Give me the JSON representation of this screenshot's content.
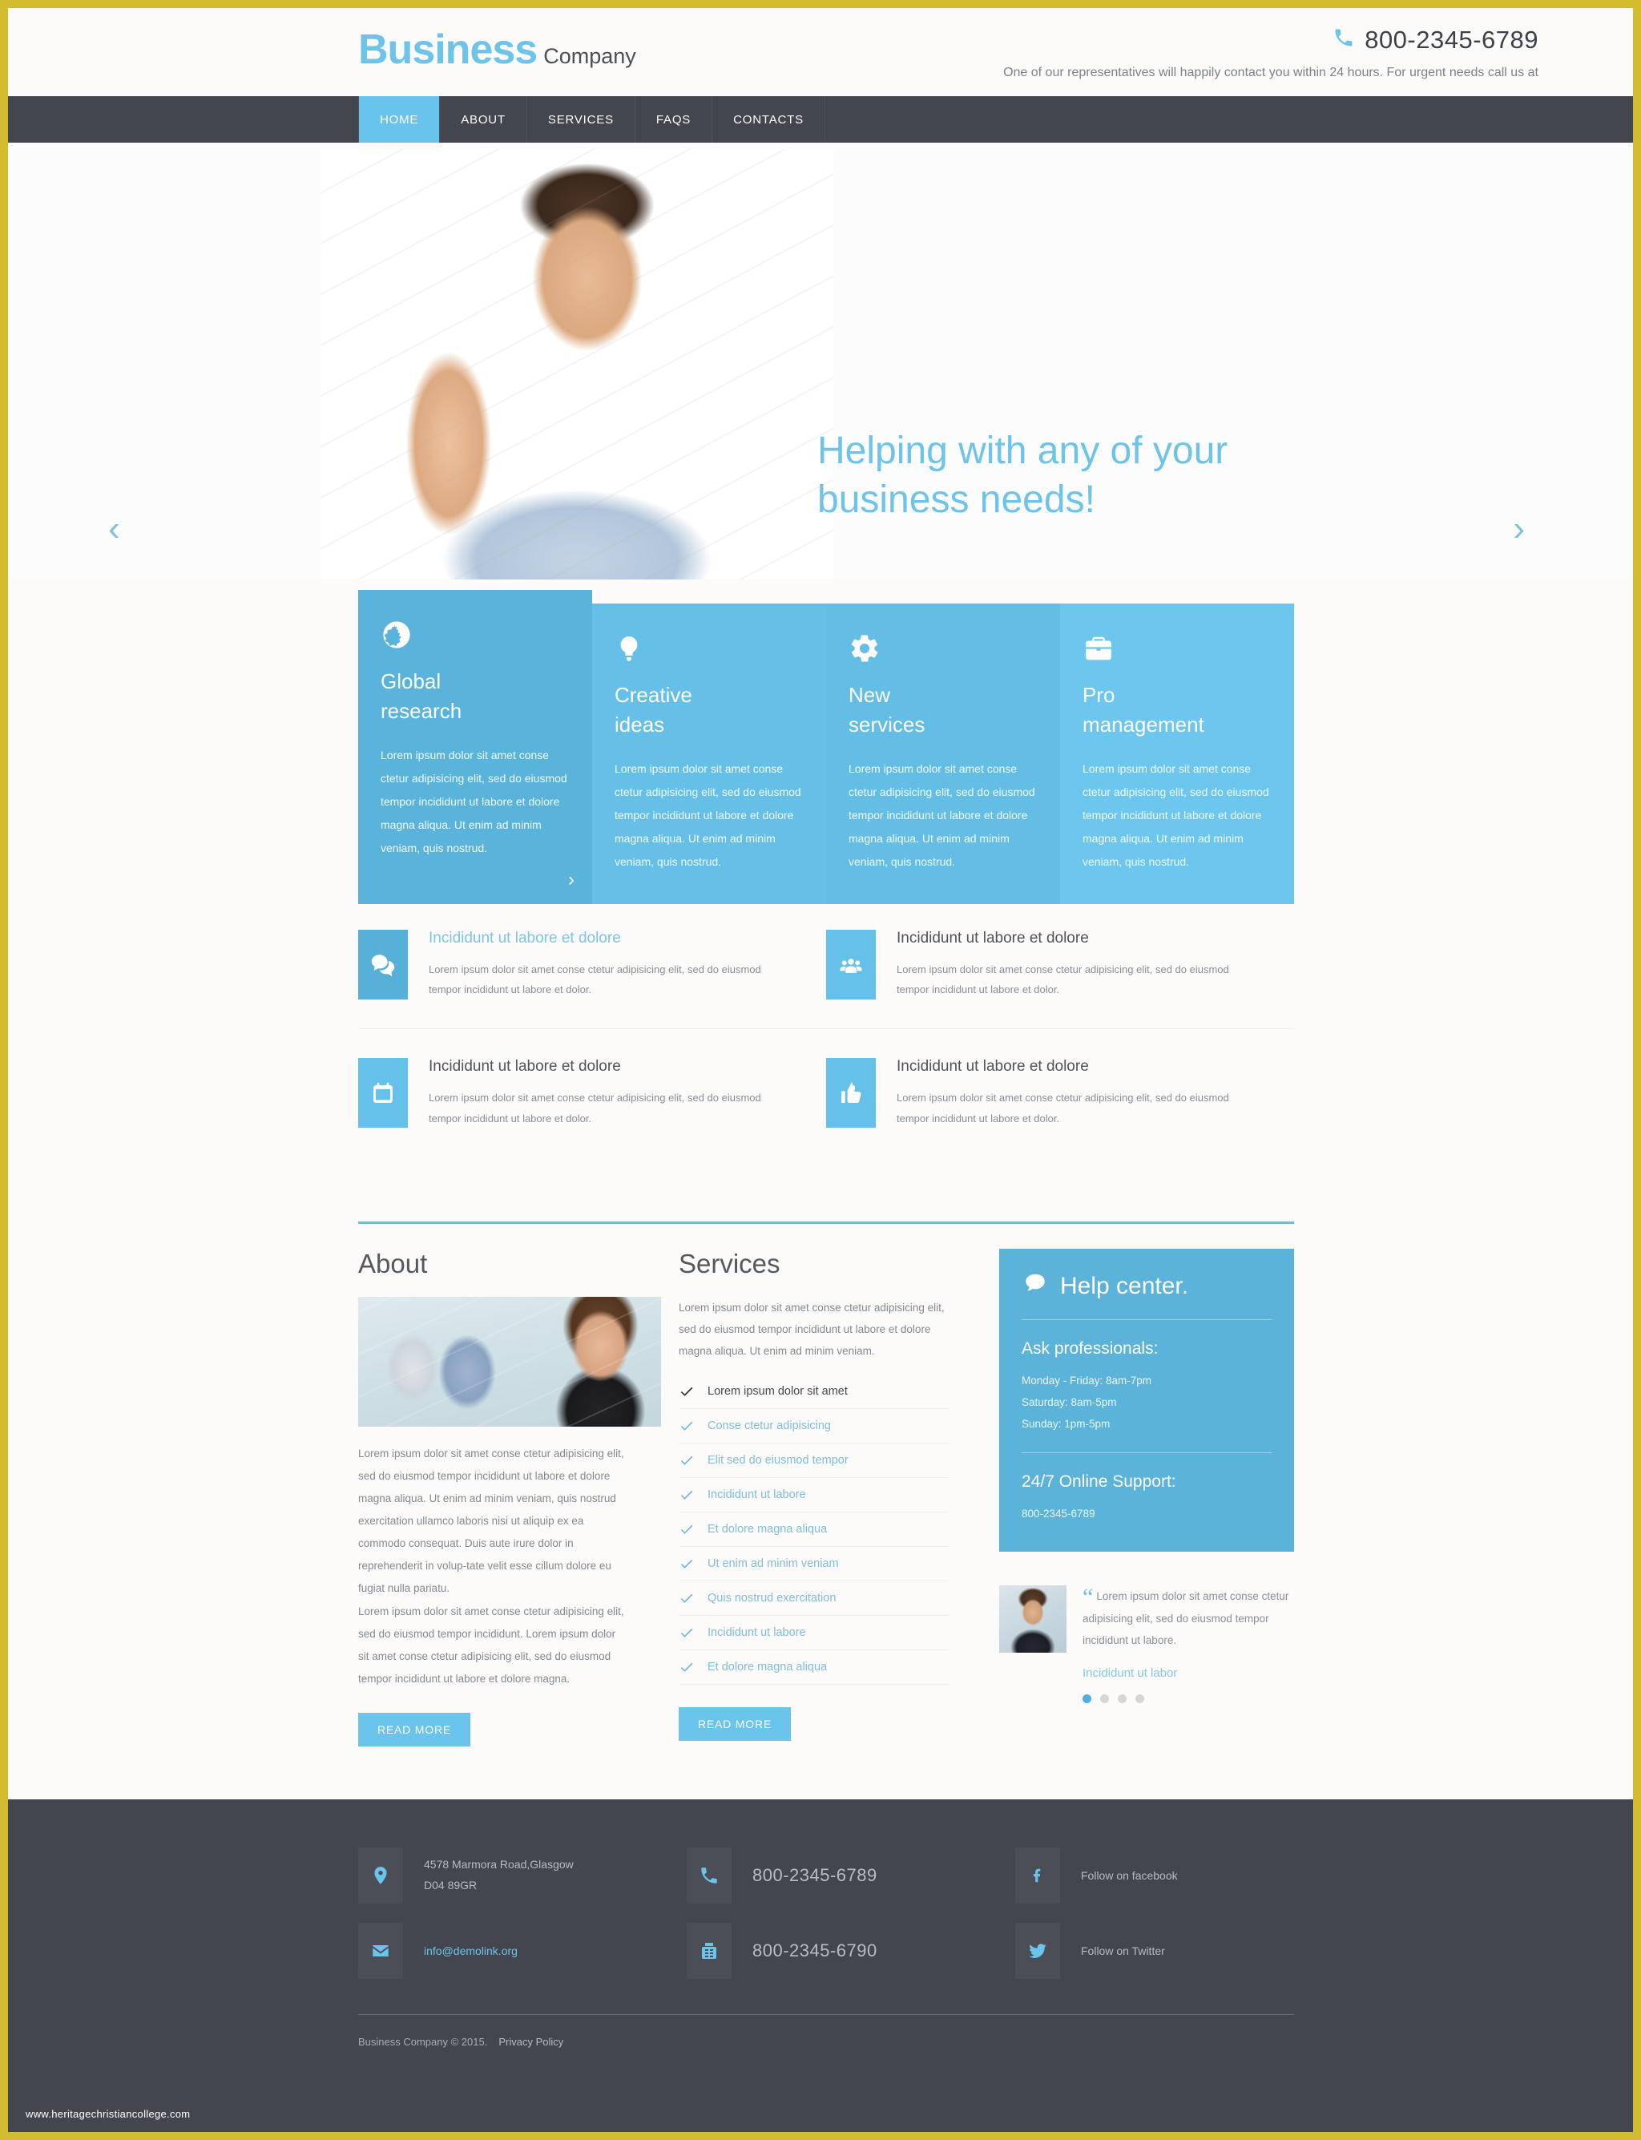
{
  "brand": {
    "name": "Business",
    "suffix": "Company"
  },
  "header": {
    "phone_icon": "phone-icon",
    "phone": "800-2345-6789",
    "note": "One of our representatives will happily contact you within 24 hours. For urgent needs call us at"
  },
  "nav": {
    "items": [
      "HOME",
      "ABOUT",
      "SERVICES",
      "FAQS",
      "CONTACTS"
    ],
    "active_index": 0
  },
  "hero": {
    "headline_line1": "Helping with any of your",
    "headline_line2": "business needs!",
    "prev_label": "‹",
    "next_label": "›",
    "accent": "#6ec3e8"
  },
  "features": [
    {
      "icon": "globe-icon",
      "title_line1": "Global",
      "title_line2": "research",
      "text": "Lorem ipsum dolor sit amet conse ctetur adipisicing elit, sed do eiusmod tempor incididunt ut labore et dolore magna aliqua. Ut enim ad minim veniam, quis nostrud.",
      "more": "›",
      "bg": "#59b3da"
    },
    {
      "icon": "lightbulb-icon",
      "title_line1": "Creative",
      "title_line2": "ideas",
      "text": "Lorem ipsum dolor sit amet conse ctetur adipisicing elit, sed do eiusmod tempor incididunt ut labore et dolore magna aliqua. Ut enim ad minim veniam, quis nostrud.",
      "bg": "#66bfe6"
    },
    {
      "icon": "gear-icon",
      "title_line1": "New",
      "title_line2": "services",
      "text": "Lorem ipsum dolor sit amet conse ctetur adipisicing elit, sed do eiusmod tempor incididunt ut labore et dolore magna aliqua. Ut enim ad minim veniam, quis nostrud.",
      "bg": "#63bde5"
    },
    {
      "icon": "briefcase-icon",
      "title_line1": "Pro",
      "title_line2": "management",
      "text": "Lorem ipsum dolor sit amet conse ctetur adipisicing elit, sed do eiusmod tempor incididunt ut labore et dolore magna aliqua. Ut enim ad minim veniam, quis nostrud.",
      "bg": "#6cc6ed"
    }
  ],
  "info_blocks": [
    {
      "icon": "speech-bubbles-icon",
      "title": "Incididunt ut labore et dolore",
      "highlight": true,
      "text": "Lorem ipsum dolor sit amet conse ctetur adipisicing elit, sed do eiusmod tempor incididunt ut labore et dolor."
    },
    {
      "icon": "users-group-icon",
      "title": "Incididunt ut labore et dolore",
      "highlight": false,
      "text": "Lorem ipsum dolor sit amet conse ctetur adipisicing elit, sed do eiusmod tempor incididunt ut labore et dolor."
    },
    {
      "icon": "calendar-icon",
      "title": "Incididunt ut labore et dolore",
      "highlight": false,
      "text": "Lorem ipsum dolor sit amet conse ctetur adipisicing elit, sed do eiusmod tempor incididunt ut labore et dolor."
    },
    {
      "icon": "thumbs-up-icon",
      "title": "Incididunt ut labore et dolore",
      "highlight": false,
      "text": "Lorem ipsum dolor sit amet conse ctetur adipisicing elit, sed do eiusmod tempor incididunt ut labore et dolor."
    }
  ],
  "about": {
    "title": "About",
    "image_alt": "business-team-photo",
    "paragraph1": "Lorem ipsum dolor sit amet conse ctetur adipisicing elit, sed do eiusmod tempor incididunt ut labore et dolore magna aliqua. Ut enim ad minim veniam, quis nostrud exercitation ullamco laboris nisi ut aliquip ex ea commodo consequat. Duis aute irure dolor in reprehenderit in volup-tate velit esse cillum dolore eu fugiat nulla pariatu.",
    "paragraph2": "Lorem ipsum dolor sit amet conse ctetur adipisicing elit, sed do eiusmod tempor incididunt. Lorem ipsum dolor sit amet conse ctetur adipisicing elit, sed do eiusmod tempor incididunt ut labore et dolore magna.",
    "read_more": "READ MORE"
  },
  "services": {
    "title": "Services",
    "intro": "Lorem ipsum dolor sit amet conse ctetur adipisicing elit, sed do eiusmod tempor incididunt ut labore et dolore magna aliqua. Ut enim ad minim veniam.",
    "items": [
      "Lorem ipsum dolor sit amet",
      "Conse ctetur adipisicing",
      "Elit sed do eiusmod tempor",
      "Incididunt ut labore",
      "Et dolore magna aliqua",
      "Ut enim ad minim veniam",
      "Quis nostrud exercitation",
      "Incididunt ut labore",
      "Et dolore magna aliqua"
    ],
    "read_more": "READ MORE"
  },
  "help_center": {
    "icon": "speech-bubble-icon",
    "title": "Help center.",
    "ask_title": "Ask professionals:",
    "hours": [
      "Monday - Friday: 8am-7pm",
      "Saturday: 8am-5pm",
      "Sunday: 1pm-5pm"
    ],
    "support_title": "24/7 Online Support:",
    "support_phone": "800-2345-6789",
    "bg": "#5bb3da"
  },
  "testimonial": {
    "avatar_alt": "client-avatar",
    "quote_mark": "“",
    "quote": "Lorem ipsum dolor sit amet conse ctetur adipisicing elit, sed do eiusmod tempor incididunt ut labore.",
    "author": "Incididunt ut labor",
    "dots": 4,
    "active_dot": 0
  },
  "footer": {
    "address_icon": "map-pin-icon",
    "address_line1": "4578 Marmora Road,Glasgow",
    "address_line2": "D04 89GR",
    "phone_icon": "phone-icon",
    "phone": "800-2345-6789",
    "facebook_icon": "facebook-icon",
    "facebook_label": "Follow on facebook",
    "email_icon": "envelope-icon",
    "email": "info@demolink.org",
    "fax_icon": "fax-icon",
    "fax": "800-2345-6790",
    "twitter_icon": "twitter-icon",
    "twitter_label": "Follow on Twitter",
    "copyright": "Business Company © 2015.",
    "privacy": "Privacy Policy"
  },
  "watermark": "www.heritagechristiancollege.com"
}
